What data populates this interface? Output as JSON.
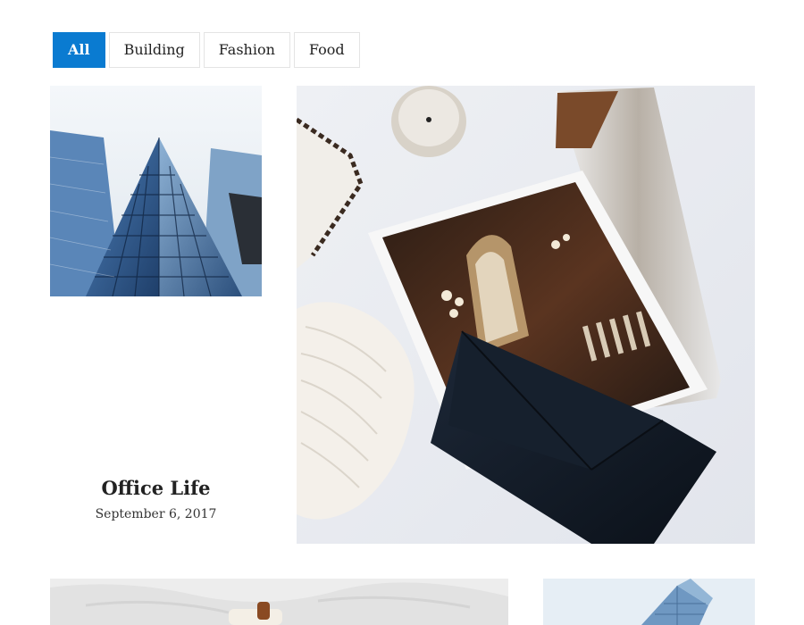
{
  "filters": {
    "items": [
      {
        "label": "All",
        "active": true
      },
      {
        "label": "Building",
        "active": false
      },
      {
        "label": "Fashion",
        "active": false
      },
      {
        "label": "Food",
        "active": false
      }
    ]
  },
  "posts": {
    "office_life": {
      "title": "Office Life",
      "date": "September 6, 2017"
    }
  },
  "colors": {
    "accent": "#0a7bd1"
  }
}
